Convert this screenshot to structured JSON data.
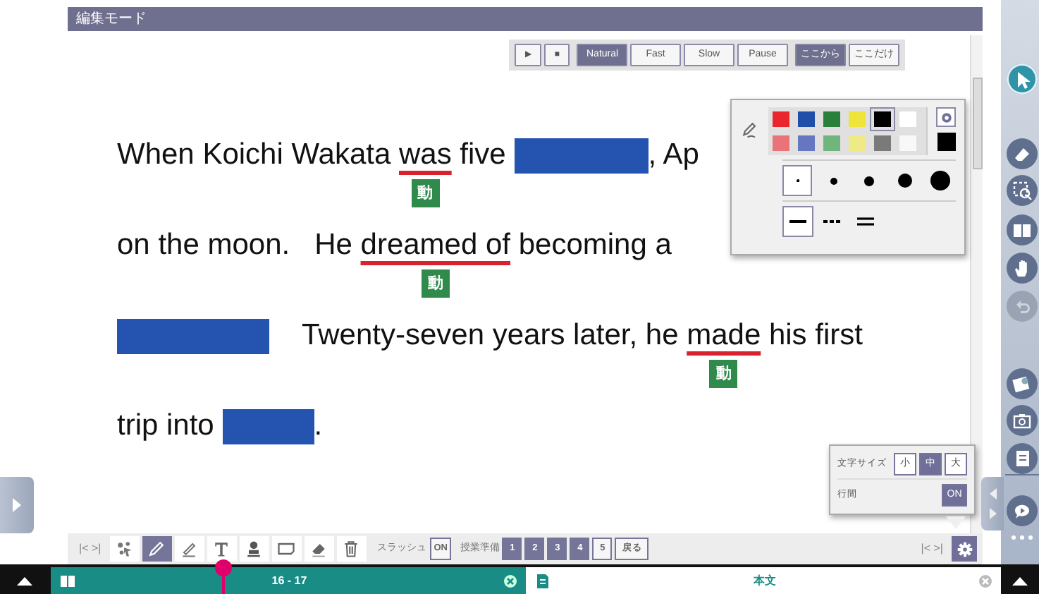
{
  "header": {
    "title": "編集モード"
  },
  "audio_toolbar": {
    "playback": [
      {
        "label": "▶"
      },
      {
        "label": "■"
      }
    ],
    "speeds": [
      {
        "label": "Natural",
        "selected": true
      },
      {
        "label": "Fast",
        "selected": false
      },
      {
        "label": "Slow",
        "selected": false
      },
      {
        "label": "Pause",
        "selected": false
      }
    ],
    "ranges": [
      {
        "label": "ここから",
        "selected": true
      },
      {
        "label": "ここだけ",
        "selected": false
      }
    ]
  },
  "passage": {
    "lines": [
      {
        "segments": [
          {
            "kind": "text",
            "text": "When Koichi Wakata "
          },
          {
            "kind": "verb",
            "text": "was",
            "tag": "動"
          },
          {
            "kind": "text",
            "text": " five "
          },
          {
            "kind": "blank"
          },
          {
            "kind": "text",
            "text": ", Ap"
          }
        ]
      },
      {
        "segments": [
          {
            "kind": "text",
            "text": "on the moon.   He "
          },
          {
            "kind": "verb",
            "text": "dreamed of",
            "tag": "動"
          },
          {
            "kind": "text",
            "text": " becoming a"
          }
        ]
      },
      {
        "segments": [
          {
            "kind": "blank"
          },
          {
            "kind": "text",
            "text": "    Twenty-seven years later, he "
          },
          {
            "kind": "verb",
            "text": "made",
            "tag": "動"
          },
          {
            "kind": "text",
            "text": " his first"
          }
        ]
      },
      {
        "segments": [
          {
            "kind": "text",
            "text": "trip into "
          },
          {
            "kind": "blank"
          },
          {
            "kind": "text",
            "text": "."
          }
        ]
      }
    ]
  },
  "pen_palette": {
    "colors": [
      {
        "color": "#e8262b",
        "selected": false
      },
      {
        "color": "#1f4fa8",
        "selected": false
      },
      {
        "color": "#2a7f3a",
        "selected": false
      },
      {
        "color": "#eee43a",
        "selected": false
      },
      {
        "color": "#000000",
        "selected": true
      },
      {
        "color": "#ffffff",
        "selected": false
      },
      {
        "color": "#ec7279",
        "selected": false
      },
      {
        "color": "#6776bf",
        "selected": false
      },
      {
        "color": "#71b47e",
        "selected": false
      },
      {
        "color": "#eeeb86",
        "selected": false
      },
      {
        "color": "#7a7a7a",
        "selected": false
      },
      {
        "color": "#f8f8f8",
        "selected": false
      }
    ],
    "sizes": [
      {
        "selected": true
      },
      {
        "selected": false
      },
      {
        "selected": false
      },
      {
        "selected": false
      },
      {
        "selected": false
      }
    ],
    "line_styles": [
      {
        "kind": "solid",
        "selected": true
      },
      {
        "kind": "dashed",
        "selected": false
      },
      {
        "kind": "double",
        "selected": false
      }
    ]
  },
  "display_settings": {
    "font_size_label": "文字サイズ",
    "font_sizes": [
      {
        "label": "小",
        "selected": false
      },
      {
        "label": "中",
        "selected": true
      },
      {
        "label": "大",
        "selected": false
      }
    ],
    "line_spacing_label": "行間",
    "line_spacing": {
      "label": "ON",
      "on": true
    }
  },
  "bottom_toolbar": {
    "nav_left": "|< >|",
    "tools": [
      {
        "selected": false
      },
      {
        "selected": true
      },
      {
        "selected": false
      },
      {
        "selected": false
      },
      {
        "selected": false
      },
      {
        "selected": false
      },
      {
        "selected": false
      },
      {
        "selected": false
      }
    ],
    "slash_label": "スラッシュ",
    "slash": {
      "label": "ON",
      "on": false
    },
    "prep_label": "授業準備",
    "prep_steps": [
      {
        "label": "1",
        "on": true
      },
      {
        "label": "2",
        "on": true
      },
      {
        "label": "3",
        "on": true
      },
      {
        "label": "4",
        "on": true
      },
      {
        "label": "5",
        "on": false
      }
    ],
    "back": "戻る",
    "nav_right": "|< >|"
  },
  "sidebar": {
    "tools": [
      {
        "selected": true,
        "disabled": false
      },
      {
        "selected": false,
        "disabled": false
      },
      {
        "selected": false,
        "disabled": false
      },
      {
        "selected": false,
        "disabled": false
      },
      {
        "selected": false,
        "disabled": false
      },
      {
        "selected": false,
        "disabled": true
      },
      {
        "selected": false,
        "disabled": false
      },
      {
        "selected": false,
        "disabled": false
      },
      {
        "selected": false,
        "disabled": false
      },
      {
        "selected": false,
        "disabled": false
      }
    ]
  },
  "status_bar": {
    "tabs": [
      {
        "label": "16 - 17",
        "selected": true
      },
      {
        "label": "本文",
        "selected": false
      }
    ]
  }
}
